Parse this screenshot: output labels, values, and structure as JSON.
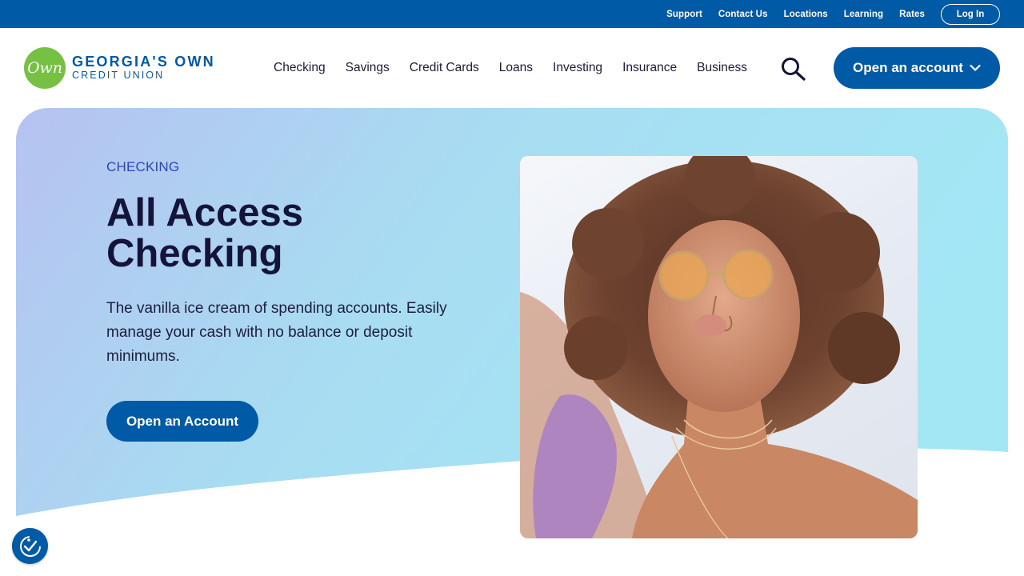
{
  "utility": {
    "links": [
      "Support",
      "Contact Us",
      "Locations",
      "Learning",
      "Rates"
    ],
    "login_label": "Log In"
  },
  "brand": {
    "logo_mark": "Own",
    "name_line1": "GEORGIA'S OWN",
    "name_line2": "CREDIT UNION"
  },
  "nav": {
    "items": [
      "Checking",
      "Savings",
      "Credit Cards",
      "Loans",
      "Investing",
      "Insurance",
      "Business"
    ],
    "search_icon": "search-icon",
    "cta_label": "Open an account"
  },
  "hero": {
    "eyebrow": "CHECKING",
    "title": "All Access Checking",
    "description": "The vanilla ice cream of spending accounts. Easily manage your cash with no balance or deposit minimums.",
    "cta_label": "Open an Account"
  },
  "colors": {
    "primary": "#005aa6",
    "accent_green": "#76c043",
    "eyebrow_blue": "#2b48b8",
    "hero_gradient_start": "#b4c3f0",
    "hero_gradient_end": "#a2e6f4"
  },
  "accessibility": {
    "icon": "accessibility-icon"
  }
}
